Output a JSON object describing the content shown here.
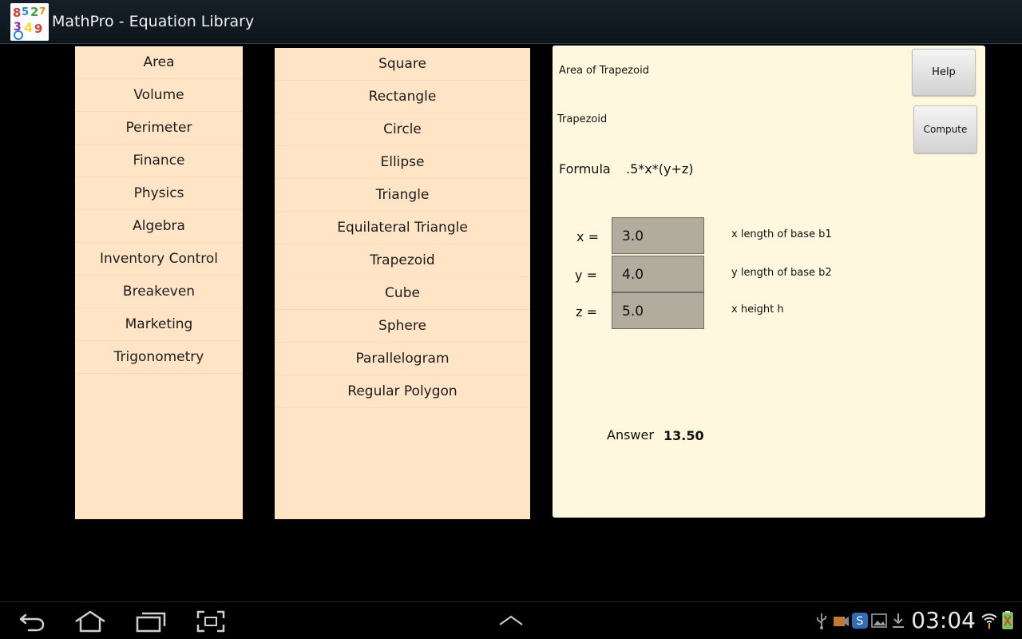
{
  "header": {
    "title": "MathPro - Equation Library",
    "logo_text": "852349"
  },
  "categories": [
    "Area",
    "Volume",
    "Perimeter",
    "Finance",
    "Physics",
    "Algebra",
    "Inventory Control",
    "Breakeven",
    "Marketing",
    "Trigonometry"
  ],
  "shapes": [
    "Square",
    "Rectangle",
    "Circle",
    "Ellipse",
    "Triangle",
    "Equilateral Triangle",
    "Trapezoid",
    "Cube",
    "Sphere",
    "Parallelogram",
    "Regular Polygon"
  ],
  "detail": {
    "heading": "Area of Trapezoid",
    "subheading": "Trapezoid",
    "formula_label": "Formula",
    "formula": ".5*x*(y+z)",
    "help_label": "Help",
    "compute_label": "Compute",
    "variables": [
      {
        "label": "x =",
        "value": "3.0",
        "description": "x  length of base b1"
      },
      {
        "label": "y =",
        "value": "4.0",
        "description": "y  length of base b2"
      },
      {
        "label": "z =",
        "value": "5.0",
        "description": "x  height h"
      }
    ],
    "answer_label": "Answer",
    "answer_value": "13.50"
  },
  "systembar": {
    "time": "03:04",
    "icons": [
      "back-icon",
      "home-icon",
      "recent-apps-icon",
      "screenshot-icon",
      "up-arrow-icon",
      "usb-icon",
      "media-icon",
      "sync-icon",
      "gallery-icon",
      "download-icon",
      "wifi-icon",
      "battery-icon"
    ]
  },
  "colors": {
    "list_bg": "#ffe4c6",
    "detail_bg": "#fff8de",
    "input_bg": "#b1ac9e"
  }
}
